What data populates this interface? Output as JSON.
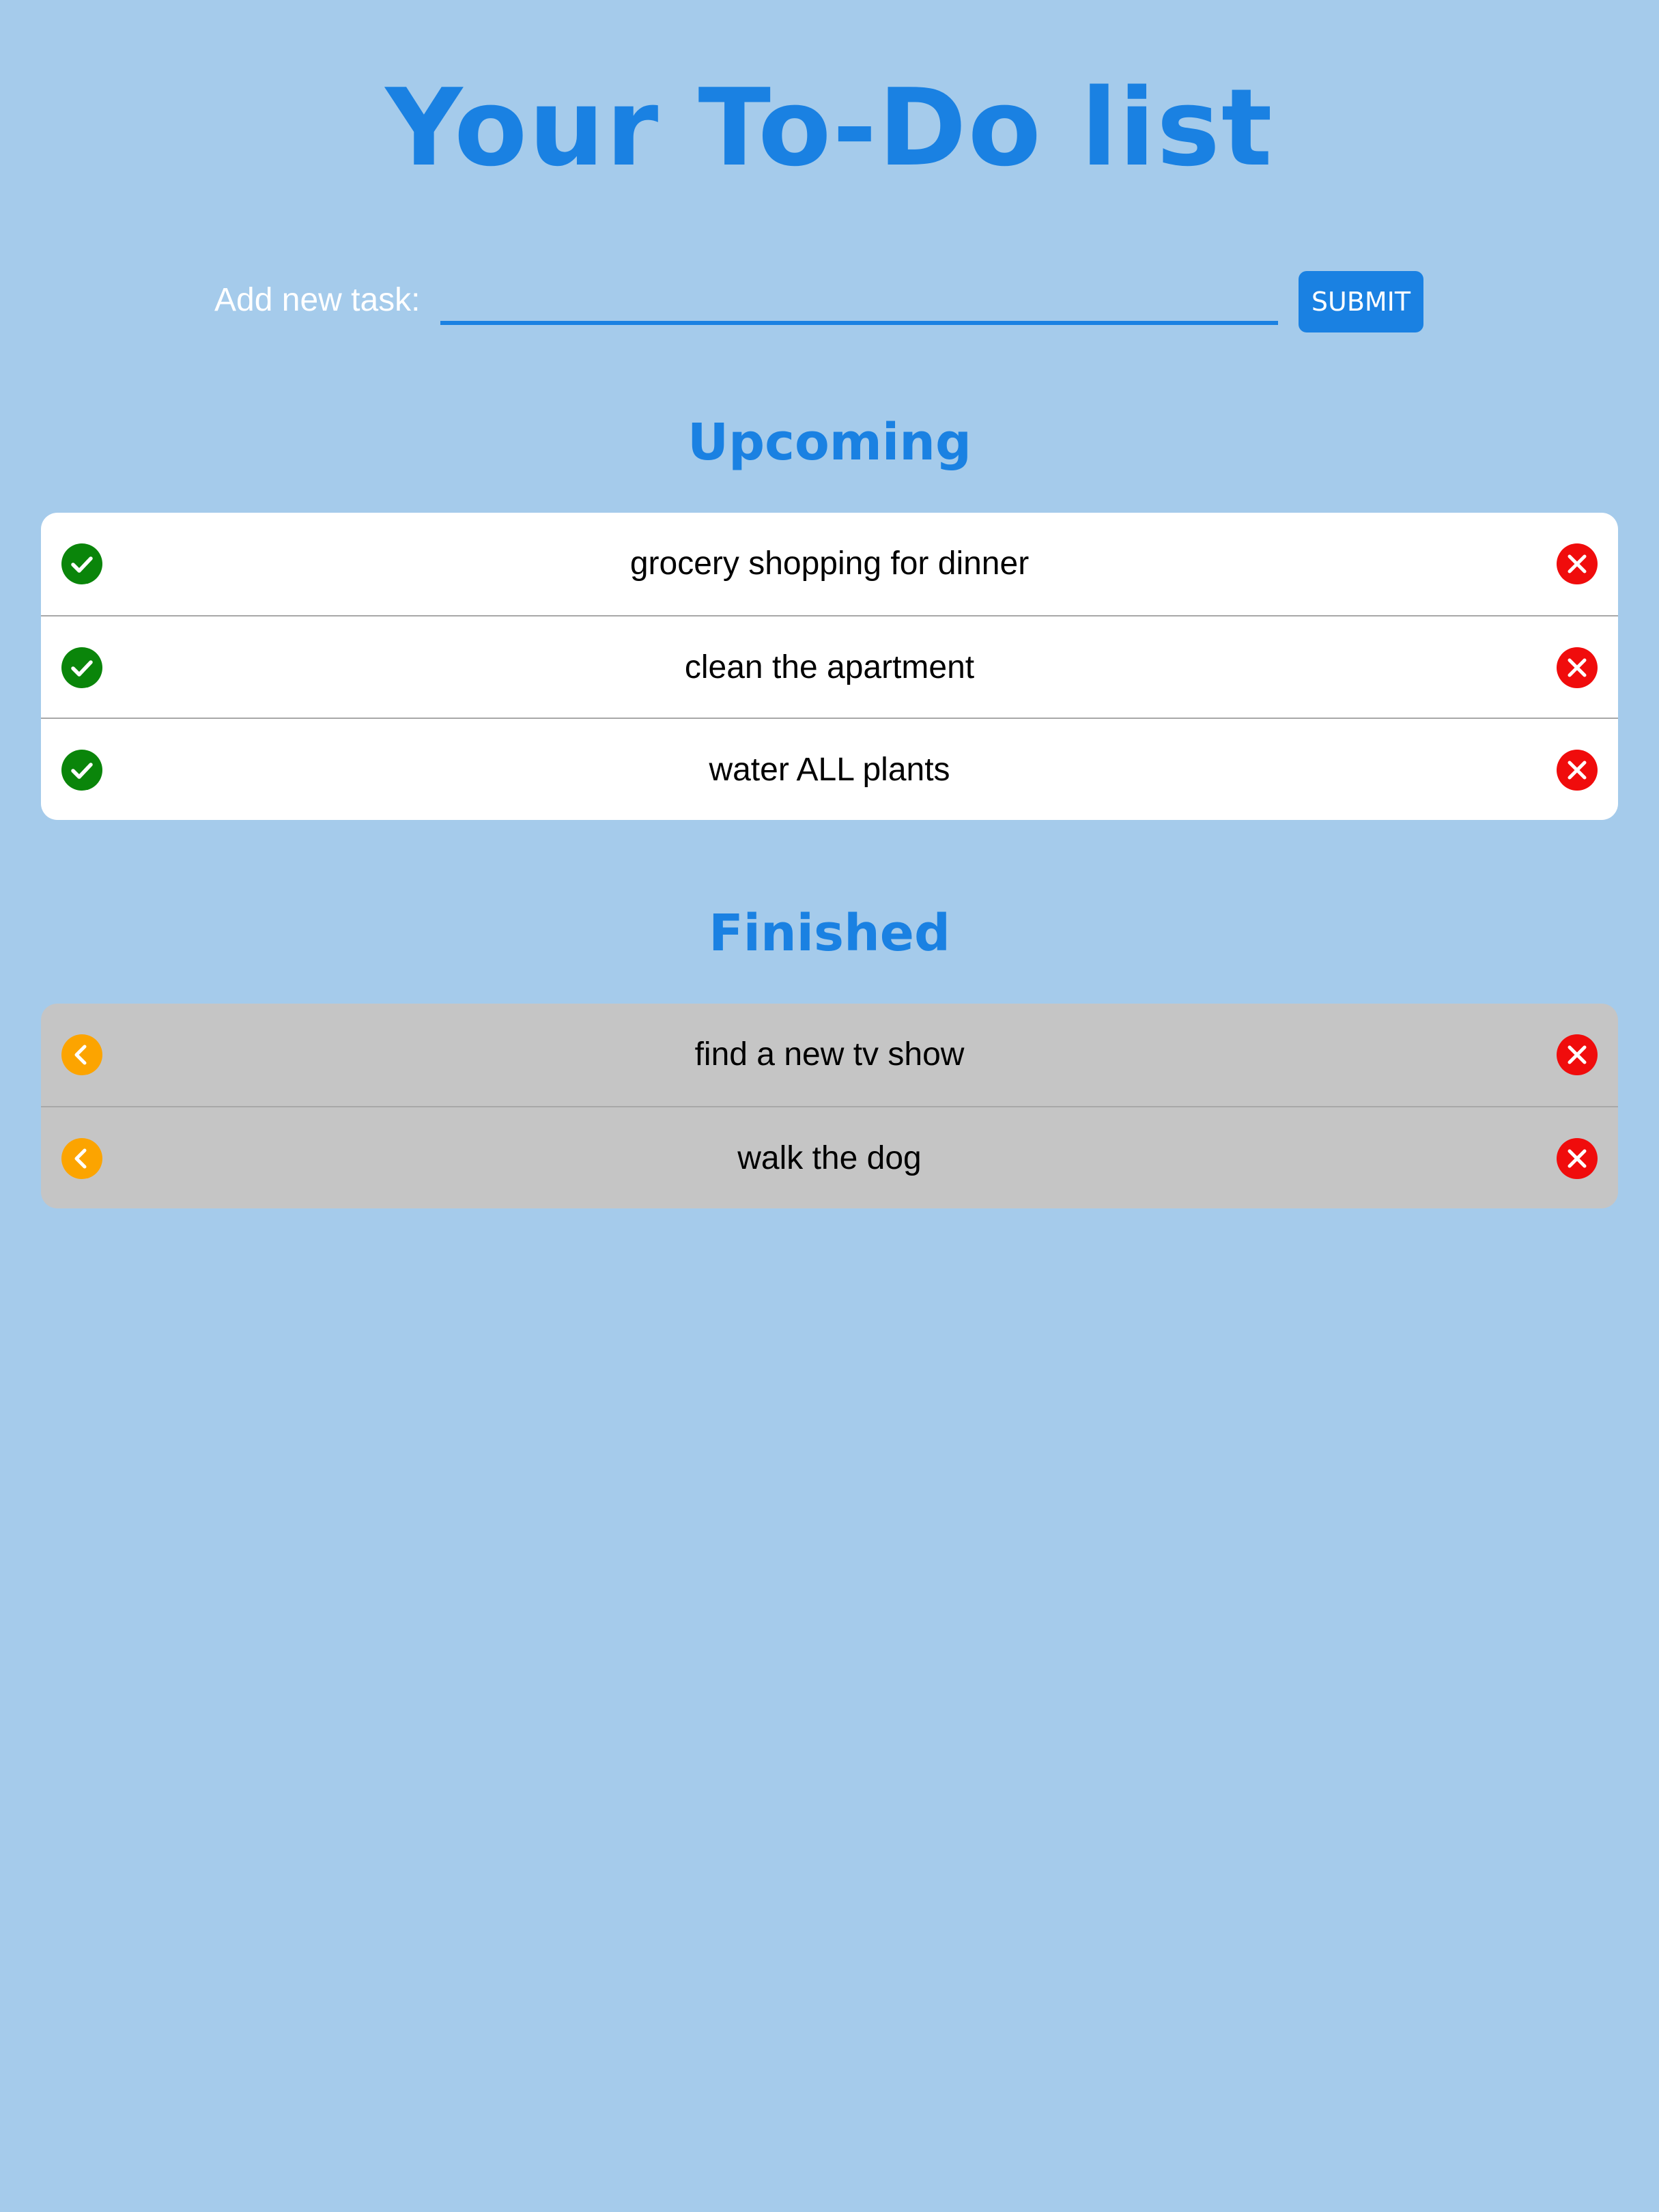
{
  "header": {
    "title": "Your To-Do list"
  },
  "add_task": {
    "label": "Add new task:",
    "input_value": "",
    "input_placeholder": "",
    "submit_label": "SUBMIT"
  },
  "upcoming": {
    "title": "Upcoming",
    "items": [
      {
        "text": "grocery shopping for dinner",
        "left_icon": "check-circle-icon",
        "right_icon": "close-circle-icon"
      },
      {
        "text": "clean the apartment",
        "left_icon": "check-circle-icon",
        "right_icon": "close-circle-icon"
      },
      {
        "text": "water ALL plants",
        "left_icon": "check-circle-icon",
        "right_icon": "close-circle-icon"
      }
    ]
  },
  "finished": {
    "title": "Finished",
    "items": [
      {
        "text": "find a new tv show",
        "left_icon": "undo-chevron-left-icon",
        "right_icon": "close-circle-icon"
      },
      {
        "text": "walk the dog",
        "left_icon": "undo-chevron-left-icon",
        "right_icon": "close-circle-icon"
      }
    ]
  },
  "colors": {
    "background": "#a5cbeb",
    "accent": "#1a81e2",
    "complete_green": "#0a850a",
    "delete_red": "#f00c0c",
    "restore_orange": "#fca400",
    "finished_row_bg": "#c5c5c5"
  }
}
